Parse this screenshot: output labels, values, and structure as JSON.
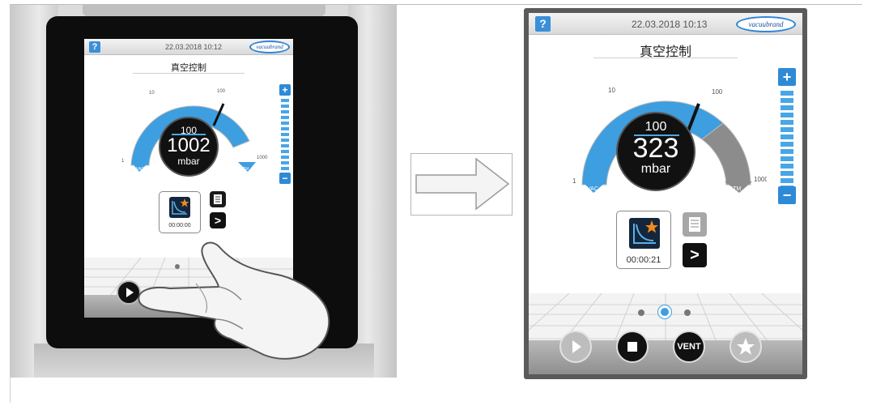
{
  "left_device": {
    "help_label": "?",
    "datetime": "22.03.2018  10:12",
    "logo_text": "vacuubrand",
    "title": "真空控制",
    "gauge": {
      "setpoint": "100",
      "current": "1002",
      "unit": "mbar",
      "scale_labels": [
        "1",
        "10",
        "100",
        "1000"
      ],
      "vac_label": "VAC",
      "atm_label": "ATM"
    },
    "plus_label": "+",
    "minus_label": "−",
    "program_time": "00:00:00",
    "list_icon": "list-icon",
    "next_label": ">",
    "play_icon": "play-icon"
  },
  "right_device": {
    "help_label": "?",
    "datetime": "22.03.2018   10:13",
    "logo_text": "vacuubrand",
    "title": "真空控制",
    "gauge": {
      "setpoint": "100",
      "current": "323",
      "unit": "mbar",
      "scale_labels": [
        "1",
        "10",
        "100",
        "1000"
      ],
      "vac_label": "VAC",
      "atm_label": "ATM"
    },
    "plus_label": "+",
    "minus_label": "−",
    "program_time": "00:00:21",
    "list_icon": "list-icon",
    "next_label": ">",
    "buttons": {
      "play_icon": "play-icon",
      "stop_icon": "stop-icon",
      "vent_label": "VENT",
      "favorite_icon": "star-icon"
    }
  },
  "arrow_icon": "arrow-right-icon",
  "colors": {
    "accent_blue": "#3d9ee0",
    "gauge_gray": "#8c8c8c",
    "screen_bg": "#ffffff",
    "button_dark": "#111111",
    "star_orange": "#f08a1c"
  }
}
